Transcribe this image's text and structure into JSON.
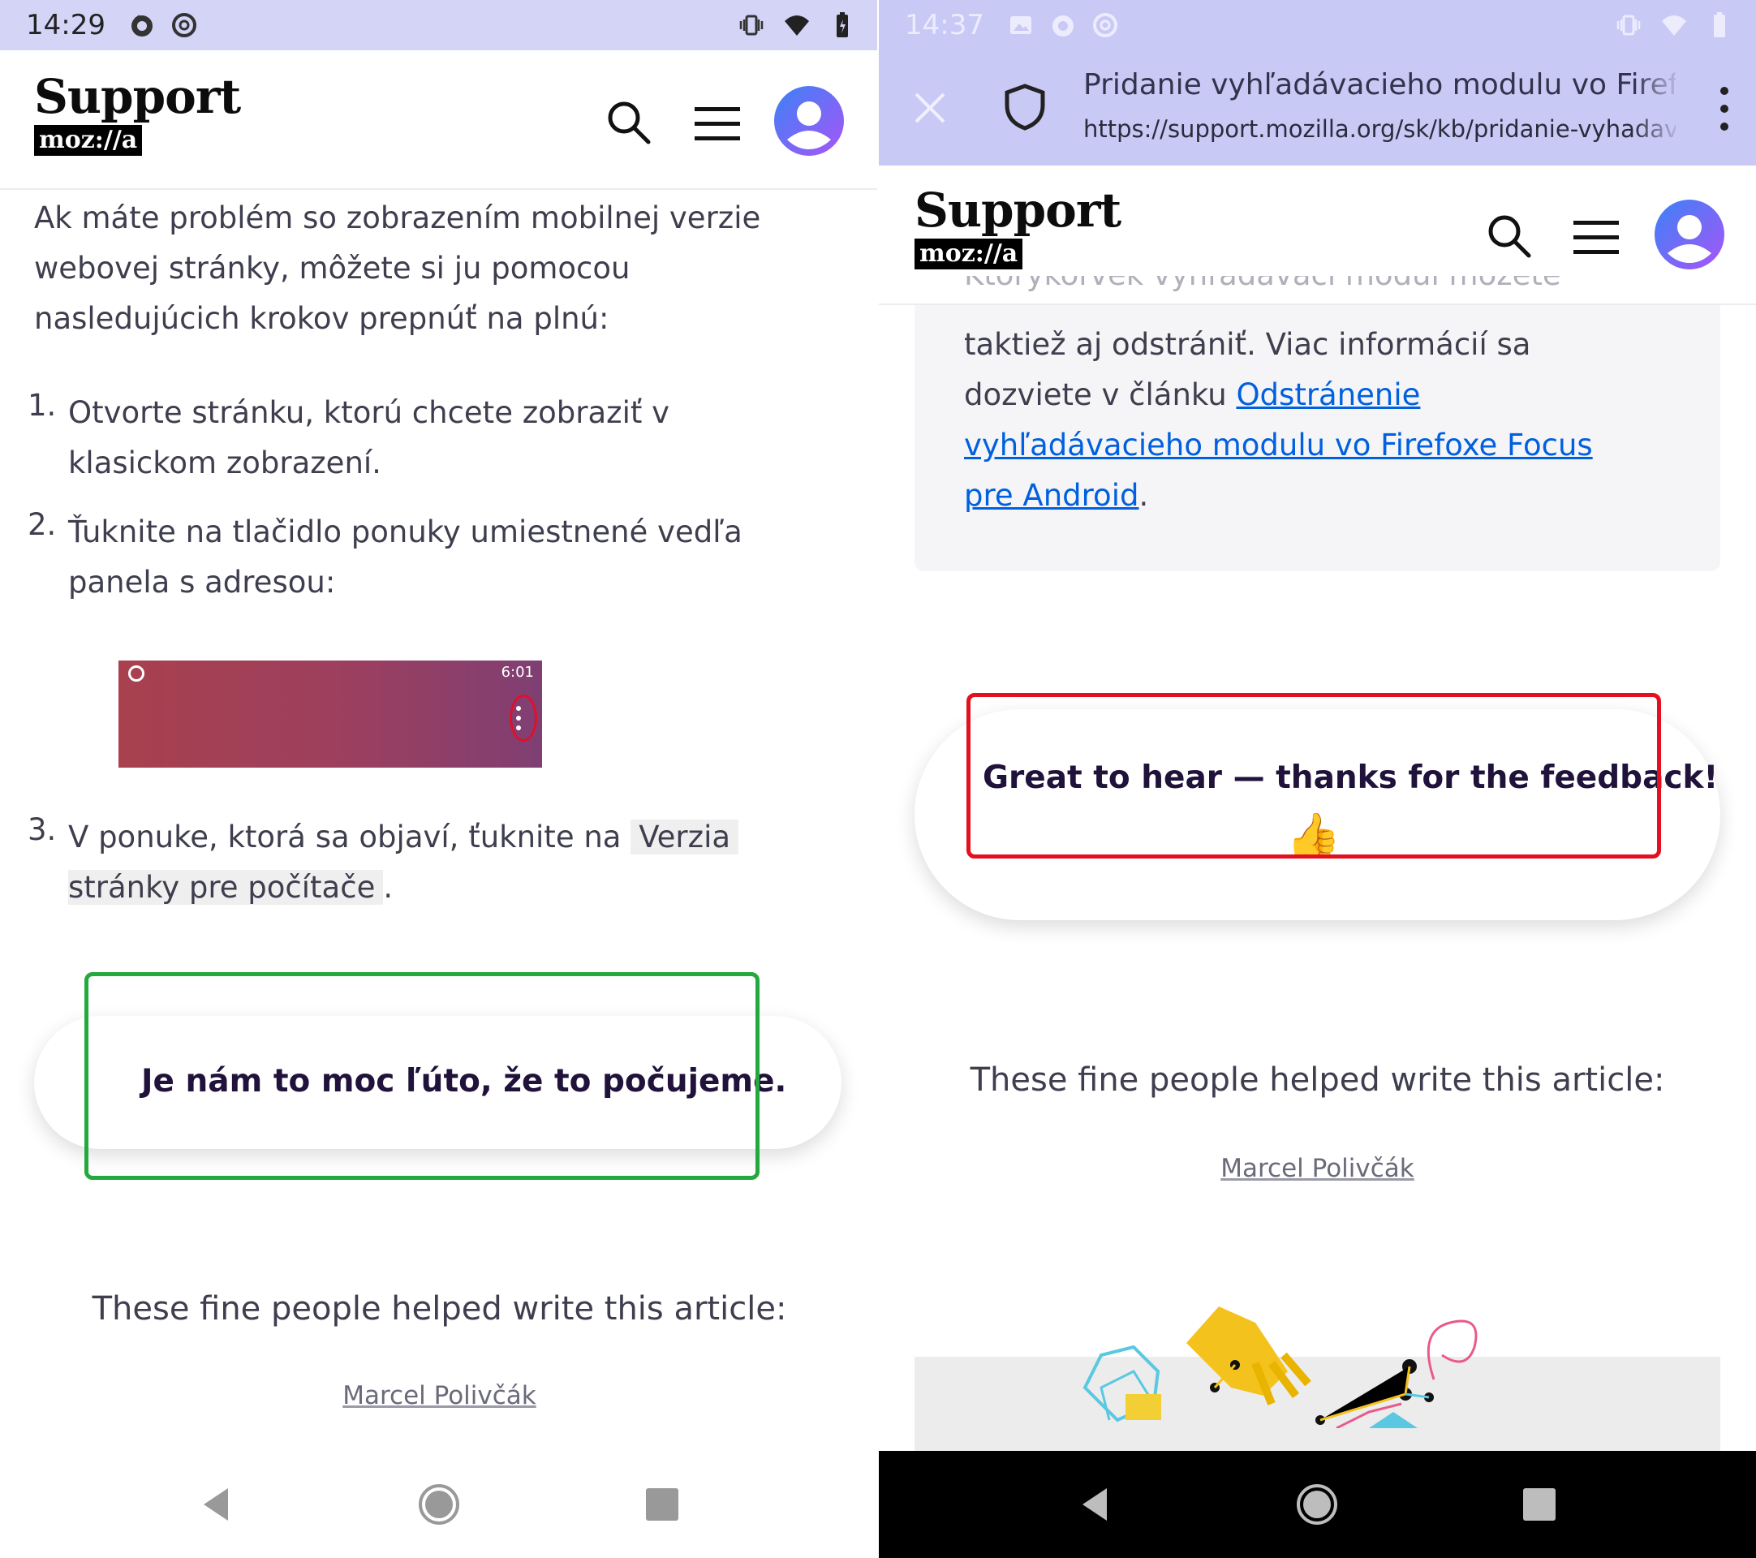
{
  "left": {
    "status": {
      "time": "14:29"
    },
    "logo": {
      "word": "Support",
      "brand": "moz://a"
    },
    "intro": "Ak máte problém so zobrazením mobilnej verzie webovej stránky, môžete si ju pomocou nasledujúcich krokov prepnúť na plnú:",
    "intro_lines": [
      "Ak máte problém so zobrazením mobilnej verzie",
      "webovej stránky, môžete si ju pomocou",
      "nasledujúcich krokov prepnúť na plnú:"
    ],
    "steps": [
      {
        "num": "1.",
        "lines": [
          "Otvorte stránku, ktorú chcete zobraziť v",
          "klasickom zobrazení."
        ]
      },
      {
        "num": "2.",
        "lines": [
          "Ťuknite na tlačidlo ponuky umiestnené vedľa",
          "panela s adresou:"
        ]
      },
      {
        "num": "3.",
        "pre": "V ponuke, ktorá sa objaví, ťuknite na",
        "code1": "Verzia",
        "code2": "stránky pre počítače",
        "post": "."
      }
    ],
    "screenshot_time": "6:01",
    "feedback_text": "Je nám to moc ľúto, že to počujeme.",
    "contributors_heading": "These fine people helped write this article:",
    "contributor": "Marcel Polivčák",
    "outline_color": "#23a93e"
  },
  "right": {
    "status": {
      "time": "14:37"
    },
    "tab": {
      "title": "Pridanie vyhľadávacieho modulu vo Firefox",
      "url": "https://support.mozilla.org/sk/kb/pridanie-vyhadava"
    },
    "logo": {
      "word": "Support",
      "brand": "moz://a"
    },
    "card_lines": {
      "partial": "Ktorýkoľvek vyhľadávací modul môžete",
      "line1": "taktiež aj odstrániť. Viac informácií sa",
      "line2_pre": "dozviete v článku",
      "link1": "Odstránenie",
      "link2": "vyhľadávacieho modulu vo Firefoxe Focus",
      "link3": "pre Android",
      "post": "."
    },
    "feedback_text": "Great to hear — thanks for the feedback!",
    "feedback_emoji": "👍",
    "contributors_heading": "These fine people helped write this article:",
    "contributor": "Marcel Polivčák",
    "outline_color": "#e3101f"
  }
}
